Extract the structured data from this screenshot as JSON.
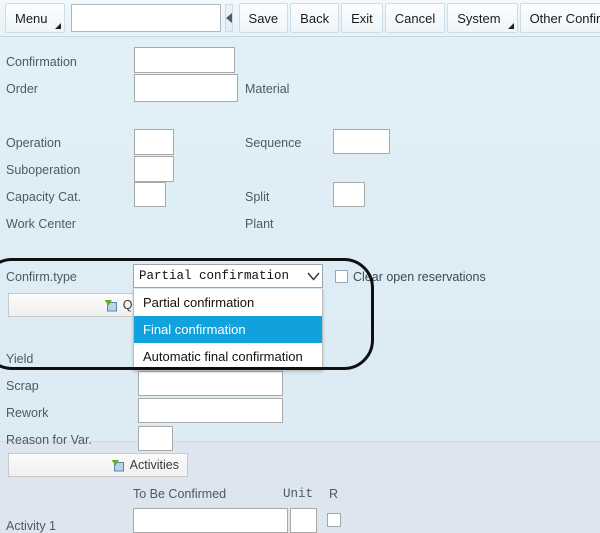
{
  "toolbar": {
    "menu_label": "Menu",
    "omnibox_value": "",
    "nav_back_icon": "left-triangle-icon",
    "buttons": [
      {
        "label": "Save",
        "name": "save-button"
      },
      {
        "label": "Back",
        "name": "back-button"
      },
      {
        "label": "Exit",
        "name": "exit-button"
      },
      {
        "label": "Cancel",
        "name": "cancel-button"
      },
      {
        "label": "System",
        "name": "system-menu-button"
      },
      {
        "label": "Other Confirma",
        "name": "other-confirmation-button"
      }
    ]
  },
  "form": {
    "confirmation_label": "Confirmation",
    "confirmation_value": "",
    "order_label": "Order",
    "order_value": "",
    "material_label": "Material",
    "operation_label": "Operation",
    "operation_value": "",
    "sequence_label": "Sequence",
    "sequence_value": "",
    "suboperation_label": "Suboperation",
    "suboperation_value": "",
    "capacity_cat_label": "Capacity Cat.",
    "capacity_cat_value": "",
    "split_label": "Split",
    "split_value": "",
    "work_center_label": "Work Center",
    "plant_label": "Plant"
  },
  "confirm_type": {
    "label": "Confirm.type",
    "selected": "Partial confirmation",
    "chevron_icon": "chevron-down-icon",
    "options": [
      {
        "label": "Partial confirmation",
        "selected": false
      },
      {
        "label": "Final confirmation",
        "selected": true
      },
      {
        "label": "Automatic final confirmation",
        "selected": false
      }
    ],
    "highlight_color": "#11a2dd"
  },
  "clear_reservations": {
    "label": "Clear open reservations",
    "checked": false
  },
  "quantities": {
    "button_label": "Quantities",
    "icon": "folder-expand-icon",
    "yield_label": "Yield",
    "yield_value": "",
    "scrap_label": "Scrap",
    "scrap_value": "",
    "rework_label": "Rework",
    "rework_value": "",
    "reason_label": "Reason for Var.",
    "reason_value": ""
  },
  "activities": {
    "button_label": "Activities",
    "icon": "folder-expand-icon",
    "col_to_be_confirmed": "To Be Confirmed",
    "col_unit": "Unit",
    "col_r": "R",
    "row_label": "Activity 1",
    "row_value": "",
    "row_unit": "",
    "row_r_checked": false
  },
  "annotation": {
    "shape": "rounded-rectangle-highlight",
    "color": "#101010"
  }
}
